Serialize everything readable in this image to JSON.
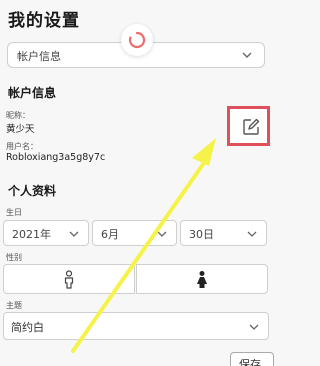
{
  "page": {
    "title": "我的设置"
  },
  "section_select": {
    "value": "帐户信息"
  },
  "account": {
    "heading": "帐户信息",
    "nickname_label": "昵称：",
    "nickname_value": "黄少天",
    "username_label": "用户名：",
    "username_value": "Robloxiang3a5g8y7c"
  },
  "profile": {
    "heading": "个人资料",
    "birthday_label": "生日",
    "year": "2021年",
    "month": "6月",
    "day": "30日",
    "gender_label": "性别"
  },
  "theme": {
    "label": "主题",
    "value": "简约白"
  },
  "actions": {
    "save_label": "保存"
  },
  "colors": {
    "highlight": "#e0505a",
    "arrow": "#f5f24a",
    "spinner": "#ef6b6b"
  },
  "icons": [
    "refresh-spinner-icon",
    "chevron-down-icon",
    "edit-icon",
    "male-icon",
    "female-icon",
    "arrow-annotation"
  ]
}
